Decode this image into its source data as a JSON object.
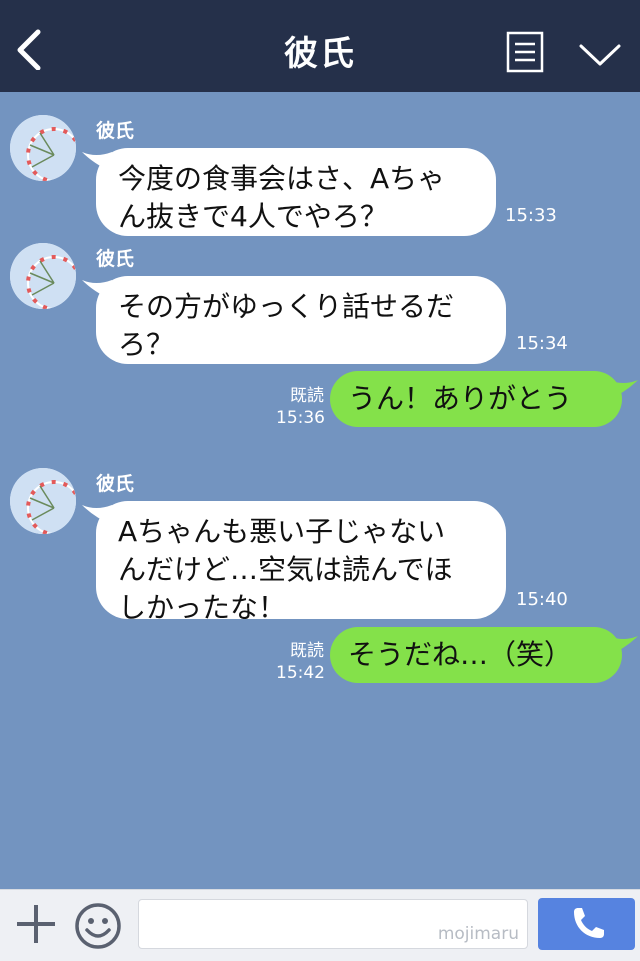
{
  "header": {
    "title": "彼氏"
  },
  "messages": [
    {
      "sender": "彼氏",
      "text": "今度の食事会はさ、Aちゃ\nん抜きで4人でやろ？",
      "time": "15:33"
    },
    {
      "sender": "彼氏",
      "text": "その方がゆっくり話せるだ\nろ？",
      "time": "15:34"
    },
    {
      "text": "うん！ありがとう",
      "read": "既読",
      "time": "15:36"
    },
    {
      "sender": "彼氏",
      "text": "Aちゃんも悪い子じゃない\nんだけど…空気は読んでほ\nしかったな！",
      "time": "15:40"
    },
    {
      "text": "そうだね…（笑）",
      "read": "既読",
      "time": "15:42"
    }
  ],
  "input": {
    "watermark": "mojimaru"
  },
  "colors": {
    "header": "#25304a",
    "background": "#7394c0",
    "bubble_in": "#ffffff",
    "bubble_out": "#84e14a",
    "call_button": "#5683e0"
  },
  "icons": [
    "back-arrow-icon",
    "menu-icon",
    "chevron-down-icon",
    "plus-icon",
    "smiley-icon",
    "phone-icon"
  ]
}
